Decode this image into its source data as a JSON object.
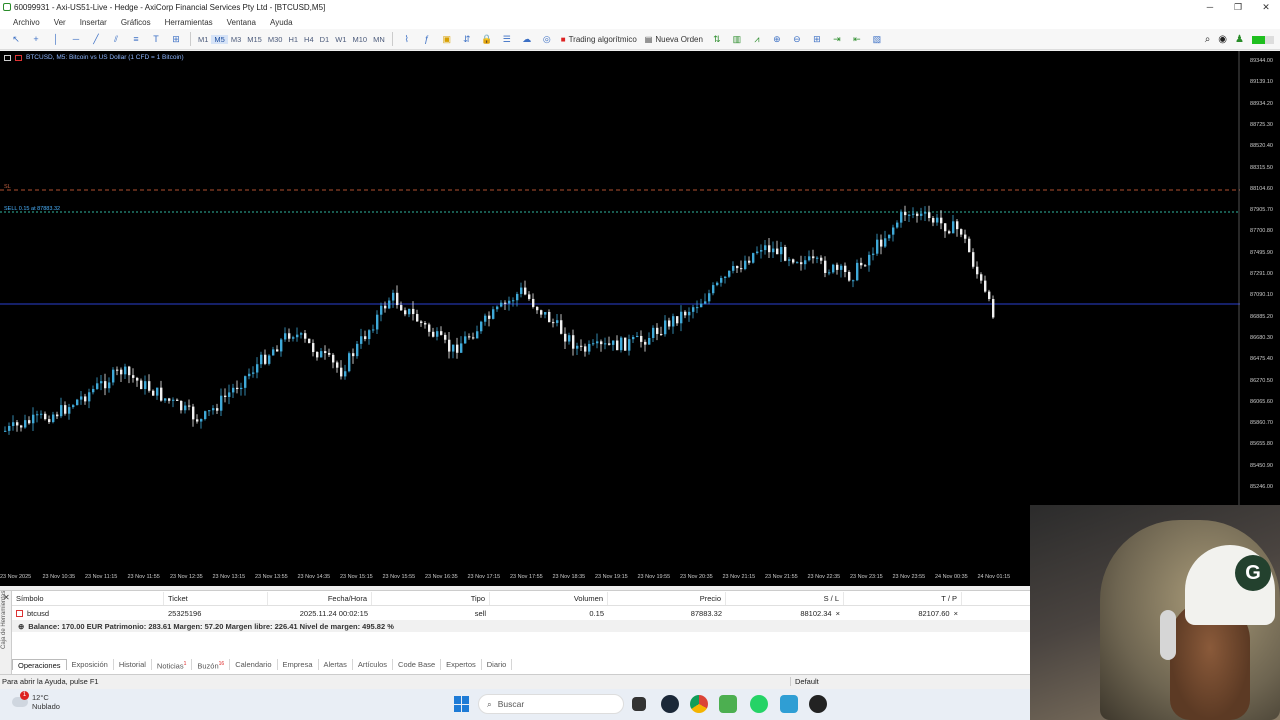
{
  "window": {
    "title": "60099931 - Axi-US51-Live - Hedge - AxiCorp Financial Services Pty Ltd - [BTCUSD,M5]",
    "controls": [
      "─",
      "❐",
      "✕"
    ]
  },
  "menu": [
    "Archivo",
    "Ver",
    "Insertar",
    "Gráficos",
    "Herramientas",
    "Ventana",
    "Ayuda"
  ],
  "toolbar": {
    "timeframes": [
      "M1",
      "M5",
      "M3",
      "M15",
      "M30",
      "H1",
      "H4",
      "D1",
      "W1",
      "M10",
      "MN"
    ],
    "active_timeframe": "M5",
    "algo_label": "Trading algorítmico",
    "new_order_label": "Nueva Orden"
  },
  "chart": {
    "header": "BTCUSD, M5: Bitcoin vs US Dollar (1 CFD = 1 Bitcoin)",
    "sell_tag": "SELL 0.15 at 87883.32",
    "tp_tag": "SL",
    "price_labels": [
      "89344.00",
      "89139.10",
      "88934.20",
      "88725.30",
      "88520.40",
      "88315.50",
      "88104.60",
      "87905.70",
      "87700.80",
      "87495.90",
      "87291.00",
      "87090.10",
      "86885.20",
      "86680.30",
      "86475.40",
      "86270.50",
      "86065.60",
      "85860.70",
      "85655.80",
      "85450.90",
      "85246.00"
    ],
    "time_labels": [
      "23 Nov 2025",
      "23 Nov 10:35",
      "23 Nov 11:15",
      "23 Nov 11:55",
      "23 Nov 12:35",
      "23 Nov 13:15",
      "23 Nov 13:55",
      "23 Nov 14:35",
      "23 Nov 15:15",
      "23 Nov 15:55",
      "23 Nov 16:35",
      "23 Nov 17:15",
      "23 Nov 17:55",
      "23 Nov 18:35",
      "23 Nov 19:15",
      "23 Nov 19:55",
      "23 Nov 20:35",
      "23 Nov 21:15",
      "23 Nov 21:55",
      "23 Nov 22:35",
      "23 Nov 23:15",
      "23 Nov 23:55",
      "24 Nov 00:35",
      "24 Nov 01:15"
    ],
    "colors": {
      "bull": "#3fa9d8",
      "bear": "#f0f0f0",
      "sl_line": "#b05030",
      "entry_line": "#2fb6a0",
      "bid_line": "#2a3fd0"
    }
  },
  "terminal": {
    "side_label": "Caja de Herramientas",
    "columns": [
      "Símbolo",
      "Ticket",
      "Fecha/Hora",
      "Tipo",
      "Volumen",
      "Precio",
      "S / L",
      "T / P"
    ],
    "rows": [
      {
        "symbol": "btcusd",
        "ticket": "25325196",
        "datetime": "2025.11.24 00:02:15",
        "type": "sell",
        "volume": "0.15",
        "price": "87883.32",
        "sl": "88102.34",
        "tp": "82107.60"
      }
    ],
    "balance": "Balance: 170.00 EUR  Patrimonio: 283.61  Margen: 57.20  Margen libre: 226.41  Nivel de margen: 495.82 %",
    "tabs": [
      {
        "label": "Operaciones",
        "badge": ""
      },
      {
        "label": "Exposición",
        "badge": ""
      },
      {
        "label": "Historial",
        "badge": ""
      },
      {
        "label": "Noticias",
        "badge": "1"
      },
      {
        "label": "Buzón",
        "badge": "16"
      },
      {
        "label": "Calendario",
        "badge": ""
      },
      {
        "label": "Empresa",
        "badge": ""
      },
      {
        "label": "Alertas",
        "badge": ""
      },
      {
        "label": "Artículos",
        "badge": ""
      },
      {
        "label": "Code Base",
        "badge": ""
      },
      {
        "label": "Expertos",
        "badge": ""
      },
      {
        "label": "Diario",
        "badge": ""
      }
    ]
  },
  "status": {
    "help": "Para abrir la Ayuda, pulse F1",
    "profile": "Default"
  },
  "taskbar": {
    "temp": "12°C",
    "weather": "Nublado",
    "weather_badge": "1",
    "search_placeholder": "Buscar"
  }
}
